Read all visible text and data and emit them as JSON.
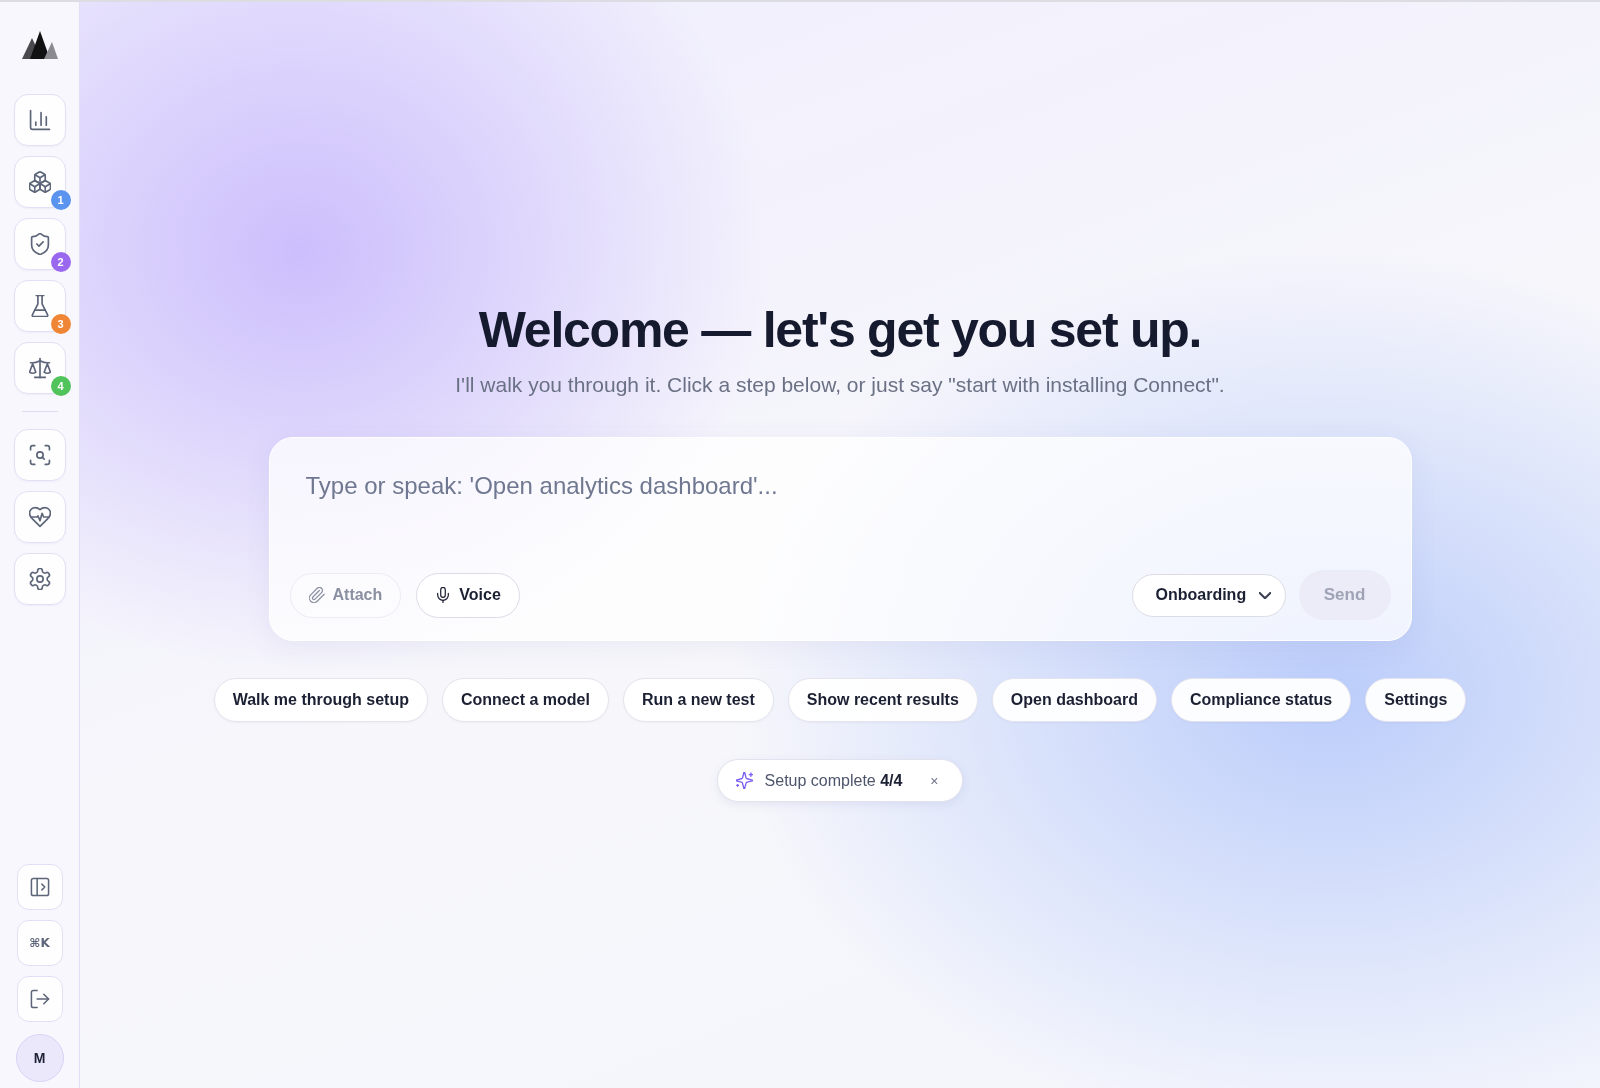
{
  "sidebar": {
    "nav_items": [
      {
        "selected": false
      },
      {
        "selected": false,
        "badge": "1",
        "color": "#5a94ef"
      },
      {
        "selected": false,
        "badge": "2",
        "color": "#9a68ef"
      },
      {
        "selected": false,
        "badge": "3",
        "color": "#ee8636"
      },
      {
        "selected": false,
        "badge": "4",
        "color": "#50c35b"
      }
    ],
    "tool_items": [
      {
        "selected": false
      },
      {
        "selected": false
      },
      {
        "selected": false
      }
    ],
    "shortcut": "⌘K",
    "avatar": "M"
  },
  "main": {
    "heading": "Welcome — let's get you set up.",
    "subtitle": "I'll walk you through it. Click a step below, or just say \"start with installing Connect\".",
    "composer": {
      "placeholder": "Type or speak: 'Open analytics dashboard'...",
      "attach": {
        "label": "Attach",
        "disabled": true
      },
      "voice": {
        "label": "Voice",
        "disabled": false
      },
      "mode": {
        "value": "Onboarding"
      },
      "send": {
        "label": "Send",
        "disabled": true
      }
    },
    "suggestions": [
      {
        "label": "Walk me through setup"
      },
      {
        "label": "Connect a model"
      },
      {
        "label": "Run a new test"
      },
      {
        "label": "Show recent results"
      },
      {
        "label": "Open dashboard"
      },
      {
        "label": "Compliance status"
      },
      {
        "label": "Settings"
      }
    ],
    "setup_status": {
      "text": "Setup complete **4/4**",
      "close": "×"
    }
  }
}
